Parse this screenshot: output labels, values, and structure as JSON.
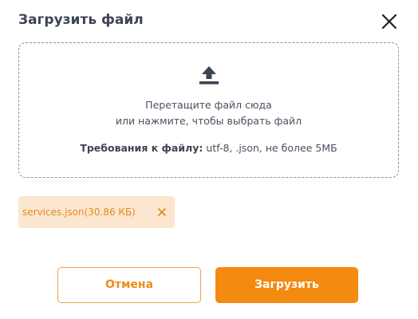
{
  "dialog": {
    "title": "Загрузить файл",
    "close_icon": "close-icon"
  },
  "dropzone": {
    "icon": "upload-icon",
    "line1": "Перетащите файл сюда",
    "line2": "или нажмите, чтобы выбрать файл",
    "requirements_label": "Требования к файлу:",
    "requirements_value": " utf-8, .json, не более 5МБ"
  },
  "file": {
    "name": "services.json(30.86 КБ)",
    "remove_icon": "remove-file-icon"
  },
  "buttons": {
    "cancel_label": "Отмена",
    "upload_label": "Загрузить"
  },
  "colors": {
    "accent": "#f48a0f",
    "chip_bg": "#fbe6cf",
    "text": "#3d4452"
  }
}
